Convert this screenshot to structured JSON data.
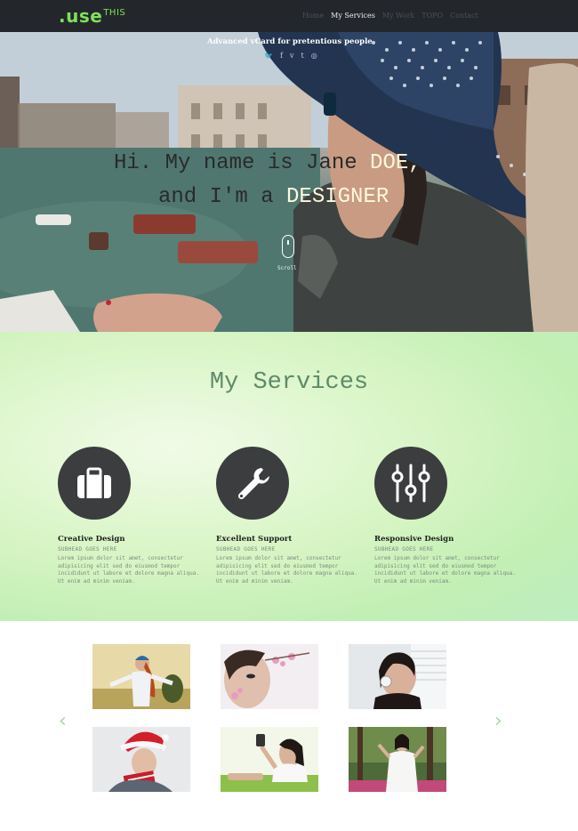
{
  "nav": {
    "logo_main": ".use",
    "logo_sup": "THIS",
    "links": [
      "Home",
      "My Services",
      "My Work",
      "TOPO",
      "Contact"
    ]
  },
  "hero": {
    "tagline": "Advanced vCard for pretentious people",
    "socials": [
      "twitter-icon",
      "facebook-icon",
      "vimeo-icon",
      "tumblr-icon",
      "dribbble-icon"
    ],
    "line1_prefix": "Hi. My name is Jane ",
    "line1_highlight": "DOE,",
    "line2_prefix": "and I'm a ",
    "line2_highlight": "DESIGNER",
    "scroll_label": "Scroll"
  },
  "services": {
    "title": "My Services",
    "items": [
      {
        "icon": "briefcase-icon",
        "title": "Creative Design",
        "subtitle": "SUBHEAD GOES HERE",
        "text": "Lorem ipsum dolor sit amet, consectetur adipisicing elit sed do eiusmod tempor incididunt ut labore et dolore magna aliqua. Ut enim ad minim veniam."
      },
      {
        "icon": "wrench-icon",
        "title": "Excellent Support",
        "subtitle": "SUBHEAD GOES HERE",
        "text": "Lorem ipsum dolor sit amet, consectetur adipisicing elit sed do eiusmod tempor incididunt ut labore et dolore magna aliqua. Ut enim ad minim veniam."
      },
      {
        "icon": "sliders-icon",
        "title": "Responsive Design",
        "subtitle": "SUBHEAD GOES HERE",
        "text": "Lorem ipsum dolor sit amet, consectetur adipisicing elit sed do eiusmod tempor incididunt ut labore et dolore magna aliqua. Ut enim ad minim veniam."
      }
    ]
  },
  "portfolio": {
    "prev_arrow": "‹",
    "next_arrow": "›",
    "thumbs": [
      "portfolio-photo-meadow",
      "portfolio-photo-flowers",
      "portfolio-photo-headphones",
      "portfolio-photo-santa",
      "portfolio-photo-camera",
      "portfolio-photo-park"
    ]
  },
  "colors": {
    "nav_bg": "#23272b",
    "logo": "#7fe05a",
    "services_bg": "#cdf2bf",
    "icon_circle": "#3b3d3f"
  }
}
